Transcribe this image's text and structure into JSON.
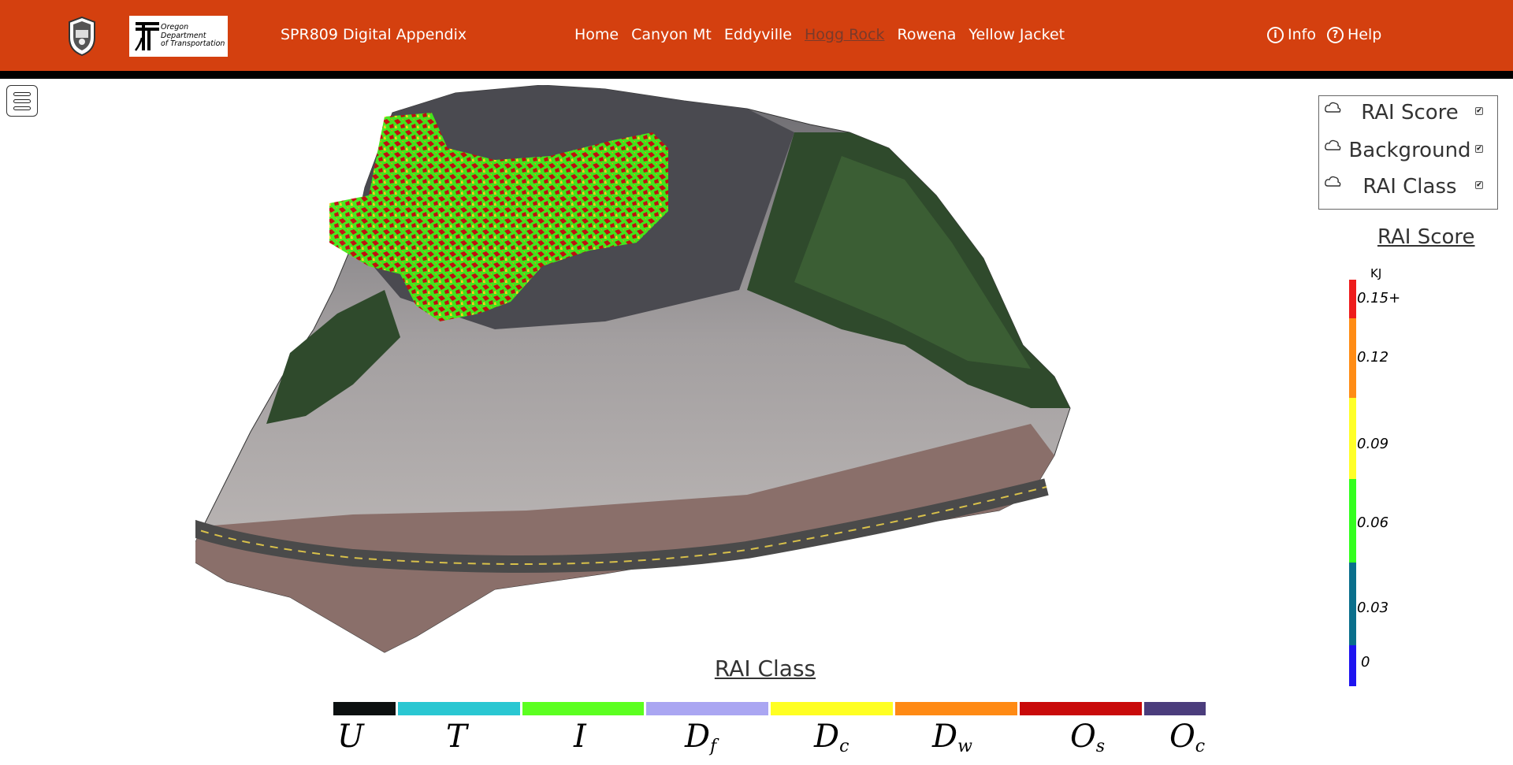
{
  "header": {
    "app_title": "SPR809 Digital Appendix",
    "logo_text": [
      "Oregon",
      "Department",
      "of Transportation"
    ],
    "nav": [
      {
        "label": "Home",
        "active": false
      },
      {
        "label": "Canyon Mt",
        "active": false
      },
      {
        "label": "Eddyville",
        "active": false
      },
      {
        "label": "Hogg Rock",
        "active": true
      },
      {
        "label": "Rowena",
        "active": false
      },
      {
        "label": "Yellow Jacket",
        "active": false
      }
    ],
    "info_label": "Info",
    "help_label": "Help",
    "info_glyph": "i",
    "help_glyph": "?"
  },
  "layers": {
    "items": [
      {
        "label": "RAI Score",
        "checked": true
      },
      {
        "label": "Background",
        "checked": true
      },
      {
        "label": "RAI Class",
        "checked": true
      }
    ]
  },
  "score_legend": {
    "title": "RAI Score",
    "unit": "KJ",
    "ticks": [
      "0.15+",
      "0.12",
      "0.09",
      "0.06",
      "0.03",
      "0"
    ],
    "colors": [
      "#ee1c1c",
      "#ff8c14",
      "#ffff28",
      "#33ff1e",
      "#0a6f8c",
      "#1e14f0"
    ]
  },
  "class_legend": {
    "title": "RAI Class",
    "items": [
      {
        "main": "U",
        "sub": "",
        "color": "#0c1010"
      },
      {
        "main": "T",
        "sub": "",
        "color": "#2ac7d2"
      },
      {
        "main": "I",
        "sub": "",
        "color": "#5cff20"
      },
      {
        "main": "D",
        "sub": "f",
        "color": "#aaa6f2"
      },
      {
        "main": "D",
        "sub": "c",
        "color": "#ffff22"
      },
      {
        "main": "D",
        "sub": "w",
        "color": "#ff8a14"
      },
      {
        "main": "O",
        "sub": "s",
        "color": "#c90a0a"
      },
      {
        "main": "O",
        "sub": "c",
        "color": "#4b3d7c"
      }
    ]
  },
  "colors": {
    "header_bg": "#d4400f",
    "active_nav": "#7a3a2a"
  }
}
